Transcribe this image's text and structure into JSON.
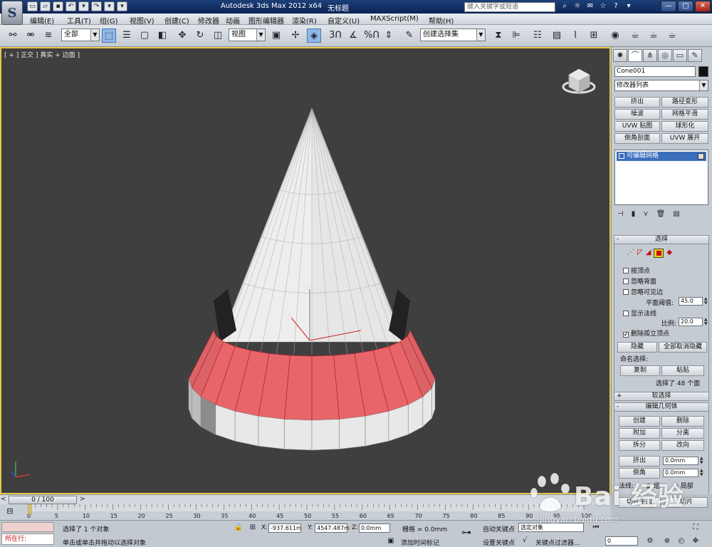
{
  "window": {
    "title": "Autodesk 3ds Max  2012 x64",
    "document": "无标题",
    "search_placeholder": "键入关键字或短语",
    "logo_letter": "S",
    "minimize": "—",
    "maximize": "□",
    "close": "✕"
  },
  "menus": [
    "编辑(E)",
    "工具(T)",
    "组(G)",
    "视图(V)",
    "创建(C)",
    "修改器",
    "动画",
    "图形编辑器",
    "渲染(R)",
    "自定义(U)",
    "MAXScript(M)",
    "帮助(H)"
  ],
  "toolbar": {
    "selection_filter": "全部",
    "reference_coord": "视图",
    "snap_3": "3",
    "snap_percent": "%",
    "selection_set": "创建选择集"
  },
  "viewport": {
    "label": "[ + ] 正交 ] 真实 + 边面 ]",
    "axis_x": "x",
    "axis_y": "y",
    "axis_z": "z",
    "selected_color": "#e8666a",
    "object_color": "#e6e6e6",
    "background": "#3f3f3f"
  },
  "command_panel": {
    "object_name": "Cone001",
    "modifier_list": "修改器列表",
    "modifier_buttons": [
      "挤出",
      "路径变形",
      "噪波",
      "网格平滑",
      "UVW 贴图",
      "球形化",
      "倒角剖面",
      "UVW 展开"
    ],
    "stack_item": "可编辑网格",
    "selection": {
      "title": "选择",
      "by_vertex": "按顶点",
      "ignore_backfacing": "忽略背面",
      "ignore_visible_edges": "忽略可见边",
      "planar_threshold_label": "平面阈值:",
      "planar_threshold": "45.0",
      "show_normals": "显示法线",
      "scale_label": "比例:",
      "scale": "20.0",
      "delete_isolated": "删除孤立顶点",
      "delete_isolated_checked": "✔",
      "hide": "隐藏",
      "unhide_all": "全部取消隐藏",
      "named_selections": "命名选择:",
      "copy": "复制",
      "paste": "粘贴",
      "selected_count": "选择了 48 个面"
    },
    "soft_selection": "软选择",
    "edit_geometry": {
      "title": "编辑几何体",
      "create": "创建",
      "delete": "删除",
      "attach": "附加",
      "detach": "分离",
      "divide": "拆分",
      "turn": "改向",
      "extrude": "挤出",
      "extrude_value": "0.0mm",
      "bevel": "倒角",
      "bevel_value": "0.0mm",
      "normal_label": "法线:",
      "group": "组",
      "local": "局部",
      "slice_plane": "切片平面",
      "slice": "切片",
      "cut": "剪切",
      "split": "分割"
    },
    "rollout_open": "-",
    "rollout_closed": "+"
  },
  "timeslider": {
    "position": "0 / 100",
    "current_fraction": 0,
    "prev": "<",
    "next": ">",
    "ticks": [
      "0",
      "5",
      "10",
      "15",
      "20",
      "25",
      "30",
      "35",
      "40",
      "45",
      "50",
      "55",
      "60",
      "65",
      "70",
      "75",
      "80",
      "85",
      "90",
      "95",
      "100"
    ]
  },
  "status": {
    "maxscript_label": "所在行:",
    "selection_info": "选择了 1 个对象",
    "prompt": "单击或单击并拖动以选择对象",
    "x_label": "X:",
    "x_value": "-937.611m",
    "y_label": "Y:",
    "y_value": "4547.487m",
    "z_label": "Z:",
    "z_value": "0.0mm",
    "grid": "栅格 = 0.0mm",
    "add_time_tag": "添加时间标记",
    "auto_key": "自动关键点",
    "set_key": "设置关键点",
    "selected_object": "选定对象",
    "key_filters": "关键点过滤器...",
    "frame": "0"
  },
  "watermark": {
    "text": "Bai 经验",
    "sub": "jingyan.baidu.com"
  }
}
